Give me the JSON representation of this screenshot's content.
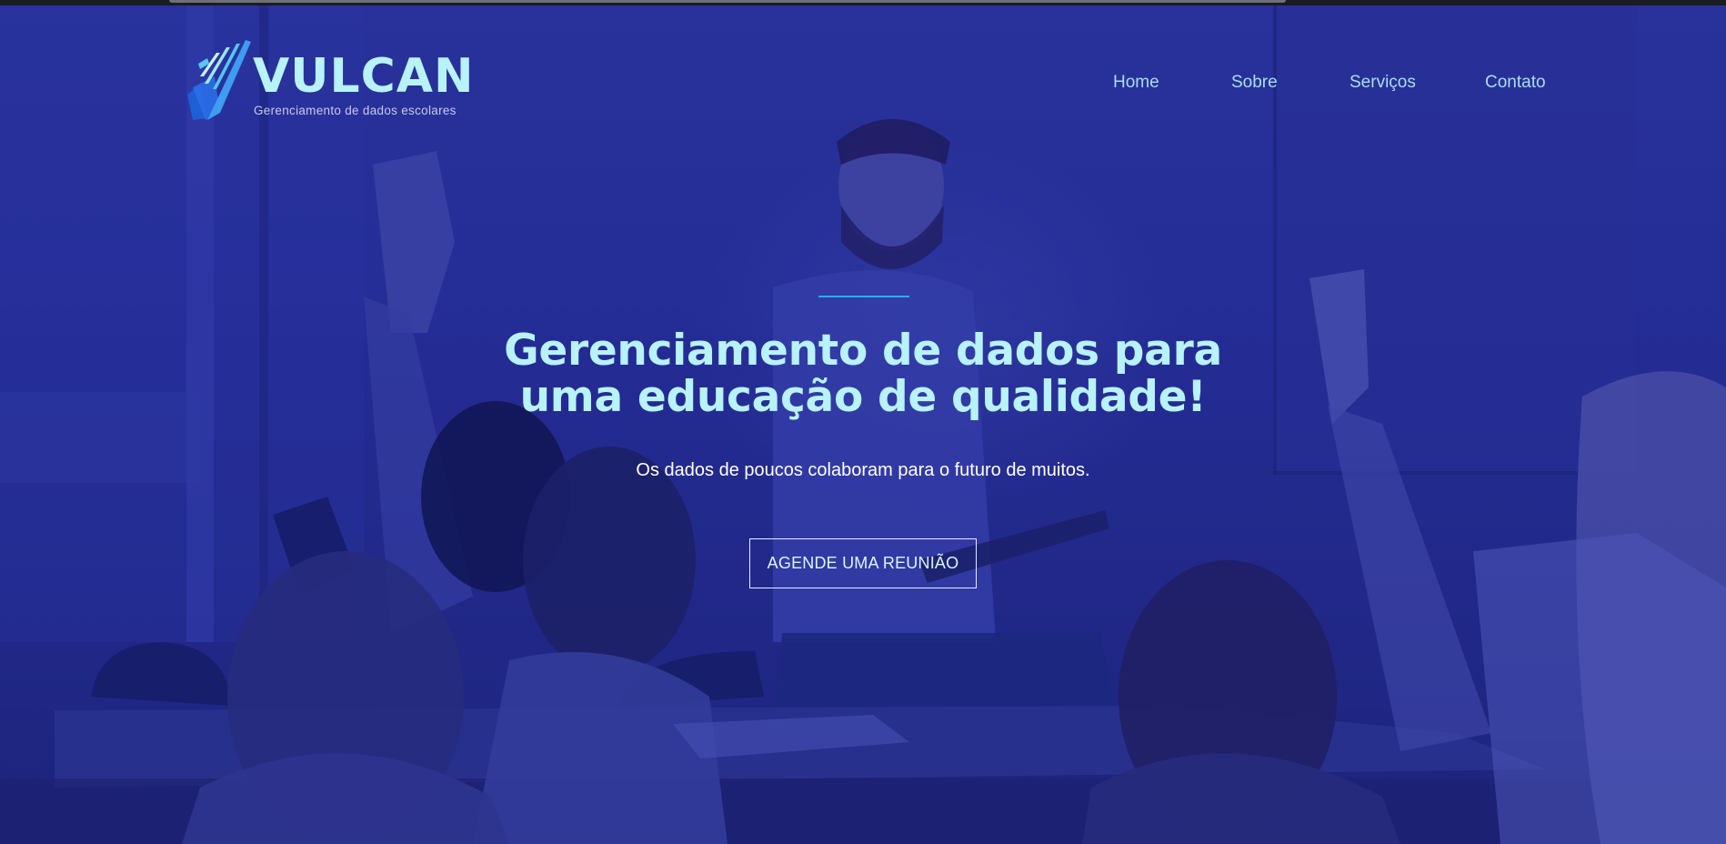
{
  "brand": {
    "name": "VULCAN",
    "tagline": "Gerenciamento de dados escolares",
    "logo_icon": "checkmark-book-icon"
  },
  "nav": {
    "items": [
      {
        "label": "Home"
      },
      {
        "label": "Sobre"
      },
      {
        "label": "Serviços"
      },
      {
        "label": "Contato"
      }
    ]
  },
  "hero": {
    "headline_line1": "Gerenciamento de dados para",
    "headline_line2": "uma educação de qualidade!",
    "subtitle": "Os dados de poucos colaboram para o futuro de muitos.",
    "cta_label": "AGENDE UMA REUNIÃO",
    "background": "classroom-photo"
  },
  "colors": {
    "accent": "#b8f2fb",
    "divider": "#1fb4e6",
    "overlay": "#242a8c",
    "nav_text": "#a8dfee"
  }
}
